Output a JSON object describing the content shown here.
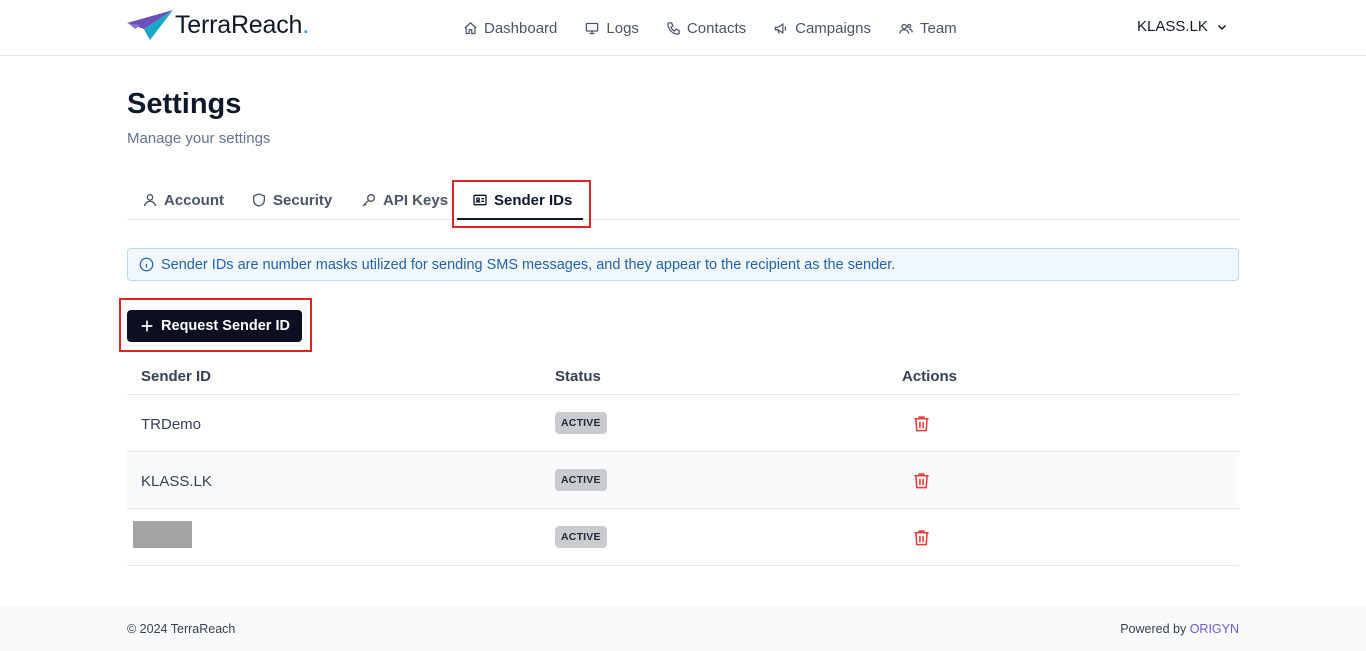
{
  "brand": {
    "name": "TerraReach",
    "dot": "."
  },
  "nav": [
    {
      "label": "Dashboard",
      "icon": "home-icon"
    },
    {
      "label": "Logs",
      "icon": "monitor-icon"
    },
    {
      "label": "Contacts",
      "icon": "phone-icon"
    },
    {
      "label": "Campaigns",
      "icon": "megaphone-icon"
    },
    {
      "label": "Team",
      "icon": "users-icon"
    }
  ],
  "account": {
    "name": "KLASS.LK"
  },
  "page": {
    "title": "Settings",
    "subtitle": "Manage your settings"
  },
  "tabs": [
    {
      "label": "Account",
      "icon": "user-icon"
    },
    {
      "label": "Security",
      "icon": "shield-icon"
    },
    {
      "label": "API Keys",
      "icon": "key-icon"
    },
    {
      "label": "Sender IDs",
      "icon": "id-card-icon",
      "active": true
    }
  ],
  "alert": {
    "text": "Sender IDs are number masks utilized for sending SMS messages, and they appear to the recipient as the sender."
  },
  "actions": {
    "request_label": "Request Sender ID"
  },
  "table": {
    "headers": {
      "sender_id": "Sender ID",
      "status": "Status",
      "actions": "Actions"
    },
    "rows": [
      {
        "sender_id": "TRDemo",
        "status": "ACTIVE"
      },
      {
        "sender_id": "KLASS.LK",
        "status": "ACTIVE"
      },
      {
        "sender_id": "",
        "status": "ACTIVE",
        "redacted": true
      }
    ]
  },
  "footer": {
    "copyright": "© 2024 TerraReach",
    "powered_prefix": "Powered by ",
    "powered_brand": "ORIGYN"
  },
  "colors": {
    "accent": "#0b0f1f",
    "highlight": "#e02424",
    "delete": "#e53e3e",
    "info": "#2563a8",
    "brand_dot": "#1ba8c7",
    "powered_brand": "#6d5bd0"
  }
}
